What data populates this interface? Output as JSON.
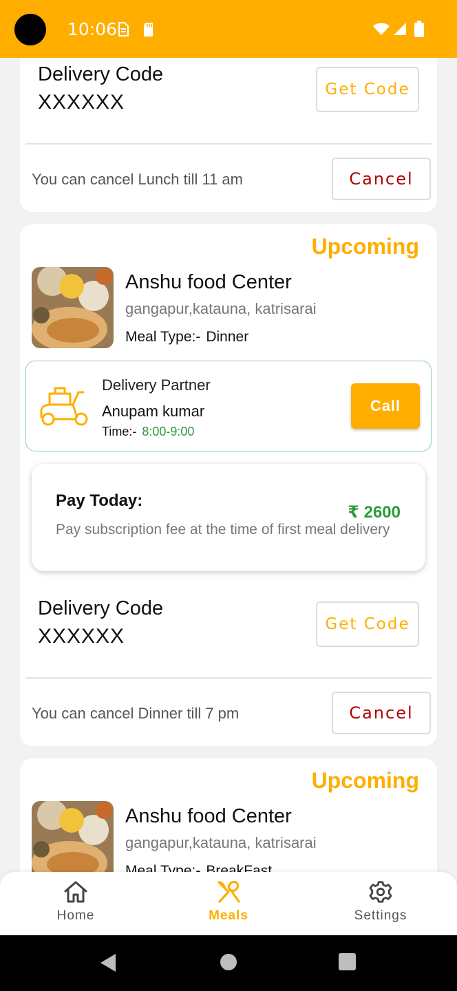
{
  "status_bar": {
    "time": "10:06"
  },
  "card1": {
    "delivery_code_label": "Delivery Code",
    "delivery_code_value": "XXXXXX",
    "get_code_label": "Get Code",
    "cancel_note": "You can cancel Lunch till 11 am",
    "cancel_label": "Cancel"
  },
  "card2": {
    "status": "Upcoming",
    "shop_name": "Anshu food Center",
    "address": "gangapur,katauna, katrisarai",
    "meal_type_label": "Meal Type:-",
    "meal_type_value": "Dinner",
    "partner_label": "Delivery Partner",
    "partner_name": "Anupam kumar",
    "time_label": "Time:-",
    "time_value": "8:00-9:00",
    "call_label": "Call",
    "pay_title": "Pay Today:",
    "pay_amount": "₹ 2600",
    "pay_desc": "Pay subscription fee at the time of first meal delivery",
    "delivery_code_label": "Delivery Code",
    "delivery_code_value": "XXXXXX",
    "get_code_label": "Get Code",
    "cancel_note": "You can cancel Dinner till 7 pm",
    "cancel_label": "Cancel"
  },
  "card3": {
    "status": "Upcoming",
    "shop_name": "Anshu food Center",
    "address": "gangapur,katauna, katrisarai",
    "meal_type_label": "Meal Type:-",
    "meal_type_value": "BreakFast"
  },
  "bottom_nav": {
    "items": [
      {
        "label": "Home",
        "icon": "home-icon",
        "active": false
      },
      {
        "label": "Meals",
        "icon": "fork-spoon-icon",
        "active": true
      },
      {
        "label": "Settings",
        "icon": "gear-icon",
        "active": false
      }
    ]
  },
  "colors": {
    "accent": "#FFAE00",
    "success": "#2e9b3c",
    "danger": "#b00000"
  }
}
